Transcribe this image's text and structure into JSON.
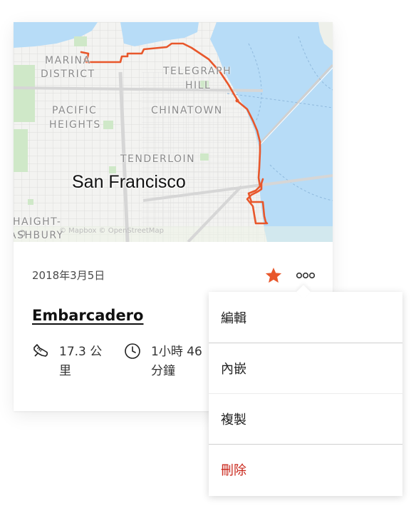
{
  "map": {
    "city": "San Francisco",
    "labels": {
      "marina_1": "MARINA",
      "marina_2": "DISTRICT",
      "telegraph_1": "TELEGRAPH",
      "telegraph_2": "HILL",
      "pacific_1": "PACIFIC",
      "pacific_2": "HEIGHTS",
      "chinatown": "CHINATOWN",
      "tenderloin": "TENDERLOIN",
      "haight_1": "HAIGHT-",
      "haight_2": "ASHBURY"
    },
    "attribution": "© Mapbox © OpenStreetMap",
    "route_color": "#e8572b",
    "water_color": "#b7dcf7"
  },
  "activity": {
    "date": "2018年3月5日",
    "title": "Embarcadero",
    "distance": "17.3 公里",
    "duration": "1小時 46分鐘"
  },
  "icons": {
    "star": "star-icon",
    "more": "more-icon",
    "shoe": "shoe-icon",
    "clock": "clock-icon"
  },
  "colors": {
    "accent": "#e8572b",
    "danger": "#c9261a"
  },
  "menu": {
    "edit": "編輯",
    "embed": "內嵌",
    "duplicate": "複製",
    "delete": "刪除"
  }
}
